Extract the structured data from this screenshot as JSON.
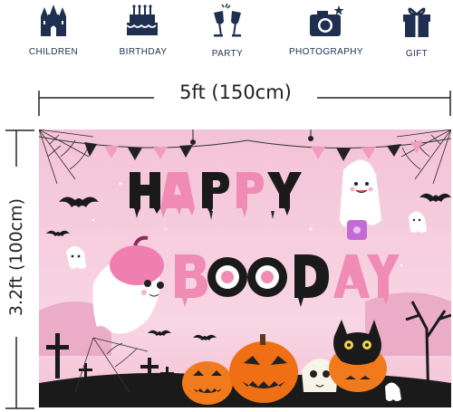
{
  "uses": [
    {
      "label": "CHILDREN",
      "icon": "castle-icon"
    },
    {
      "label": "BIRTHDAY",
      "icon": "cake-icon"
    },
    {
      "label": "PARTY",
      "icon": "toast-glasses-icon"
    },
    {
      "label": "PHOTOGRAPHY",
      "icon": "camera-icon"
    },
    {
      "label": "GIFT",
      "icon": "gift-icon"
    }
  ],
  "dimensions": {
    "width": "5ft (150cm)",
    "height": "3.2ft (100cm)"
  },
  "backdrop": {
    "title_line1": "HAPPY",
    "title_line2": "BOODAY"
  },
  "colors": {
    "icon_navy": "#1f2f4f",
    "backdrop_pink": "#f6c9dc",
    "drip_pink": "#f08cb4",
    "drip_black": "#1a1a1a",
    "pumpkin_orange": "#f07a1c"
  }
}
